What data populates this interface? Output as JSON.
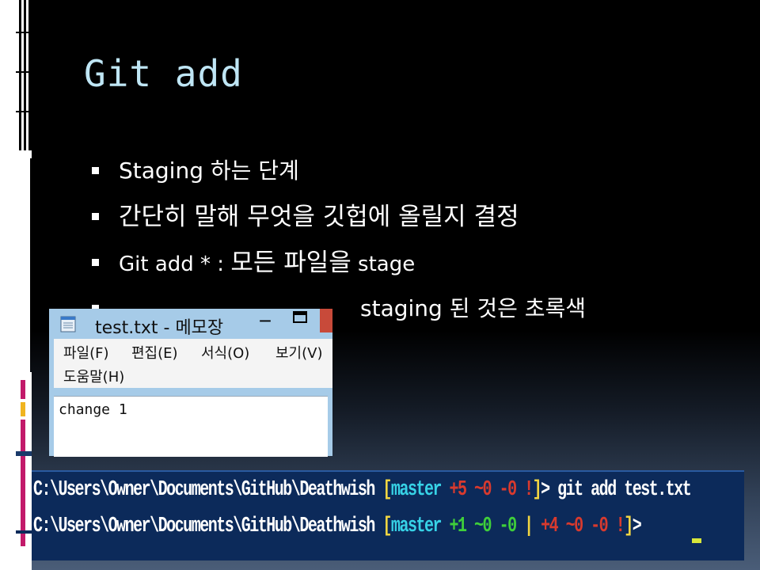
{
  "slide": {
    "title": "Git add",
    "bullets": {
      "b1": "Staging 하는 단계",
      "b2": "간단히 말해 무엇을 깃헙에 올릴지 결정",
      "b3_a": "Git add * : ",
      "b3_b": "모든 파일을",
      "b3_c": " stage",
      "b4": "staging 된 것은 초록색"
    }
  },
  "notepad": {
    "title": "test.txt - 메모장",
    "min_glyph": "─",
    "menu": {
      "file": "파일(F)",
      "edit": "편집(E)",
      "format": "서식(O)",
      "view": "보기(V)",
      "help": "도움말(H)"
    },
    "content": "change 1"
  },
  "console": {
    "line1": {
      "path": "C:\\Users\\Owner\\Documents\\GitHub\\Deathwish ",
      "open": "[",
      "branch": "master",
      "s1": " +5 ~0 -0 !",
      "close": "]",
      "prompt": "> git add test.txt"
    },
    "line2": {
      "path": "C:\\Users\\Owner\\Documents\\GitHub\\Deathwish ",
      "open": "[",
      "branch": "master",
      "s1": " +1 ~0 -0",
      "sep": " | ",
      "s2": "+4 ~0 -0 !",
      "close": "]",
      "prompt": ">"
    }
  },
  "colors": {
    "title": "#bfe6f5",
    "console_bg": "#0c2a5a",
    "branch": "#37d2e6",
    "untracked": "#d83a2e",
    "staged": "#3fcf3a",
    "bracket": "#f2d642"
  }
}
